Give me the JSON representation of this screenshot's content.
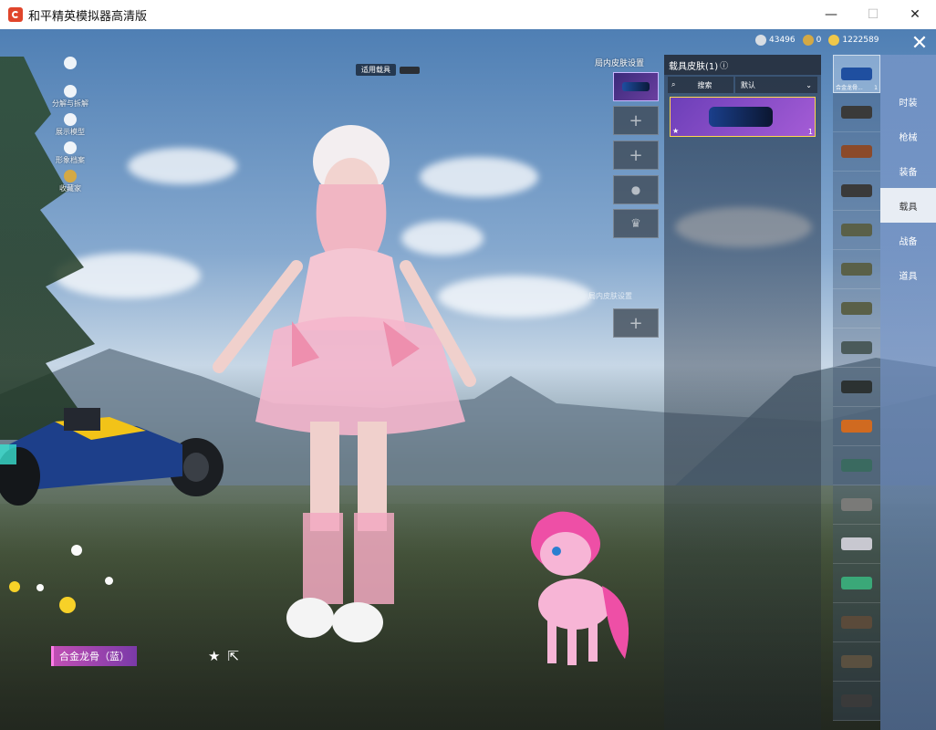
{
  "window": {
    "title": "和平精英模拟器高清版"
  },
  "window_controls": {
    "minimize": "—",
    "maximize": "☐",
    "close": "✕"
  },
  "left_menu": [
    {
      "label": "",
      "icon": "person-icon"
    },
    {
      "label": "分解与拆解",
      "icon": "puzzle-icon"
    },
    {
      "label": "展示模型",
      "icon": "eye-icon"
    },
    {
      "label": "形象档案",
      "icon": "profile-icon"
    },
    {
      "label": "收藏家",
      "icon": "collector-badge-icon"
    }
  ],
  "vehicle_tag": {
    "label": "适用载具"
  },
  "currencies": [
    {
      "value": "43496",
      "color": "#d8dde3",
      "icon": "coin-icon"
    },
    {
      "value": "0",
      "color": "#d4a945",
      "icon": "token-icon"
    },
    {
      "value": "1222589",
      "color": "#f0c84a",
      "icon": "gold-icon"
    }
  ],
  "slots": {
    "label": "局内皮肤设置",
    "lower_label": "局内皮肤设置"
  },
  "skin_panel": {
    "title": "载具皮肤(1)",
    "search": "搜索",
    "sort": "默认",
    "cards": [
      {
        "count": "1"
      }
    ]
  },
  "vehicle_list": [
    {
      "label": "合金龙骨...",
      "count": "1",
      "color": "#1f4fa0"
    },
    {
      "label": "",
      "count": "",
      "color": "#3a3a3a"
    },
    {
      "label": "",
      "count": "",
      "color": "#8b4a2a"
    },
    {
      "label": "",
      "count": "",
      "color": "#3a3a3a"
    },
    {
      "label": "",
      "count": "",
      "color": "#5a6048"
    },
    {
      "label": "",
      "count": "",
      "color": "#5a6048"
    },
    {
      "label": "",
      "count": "",
      "color": "#5a6048"
    },
    {
      "label": "",
      "count": "",
      "color": "#4a5a5a"
    },
    {
      "label": "",
      "count": "",
      "color": "#2c3232"
    },
    {
      "label": "",
      "count": "",
      "color": "#d06a20"
    },
    {
      "label": "",
      "count": "",
      "color": "#3a6a60"
    },
    {
      "label": "",
      "count": "",
      "color": "#7a7a78"
    },
    {
      "label": "",
      "count": "",
      "color": "#c8c8d0"
    },
    {
      "label": "",
      "count": "",
      "color": "#3aa878"
    },
    {
      "label": "",
      "count": "",
      "color": "#5a4a3a"
    },
    {
      "label": "",
      "count": "",
      "color": "#5a5040"
    },
    {
      "label": "",
      "count": "",
      "color": "#3a3a3a"
    }
  ],
  "right_nav": [
    "时装",
    "枪械",
    "装备",
    "载具",
    "战备",
    "道具"
  ],
  "right_nav_active": "载具",
  "item_name": "合金龙骨（蓝）"
}
